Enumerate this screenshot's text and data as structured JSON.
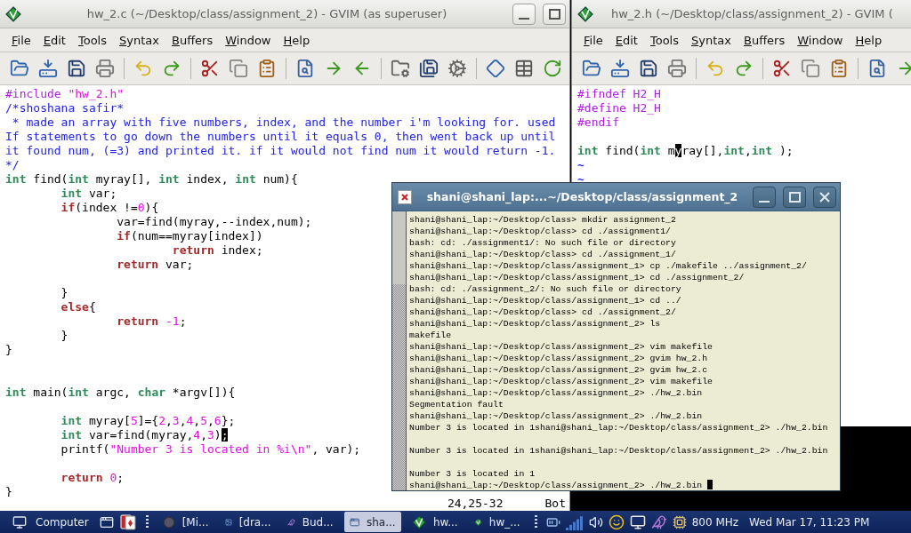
{
  "editor_left": {
    "title": "hw_2.c (~/Desktop/class/assignment_2) - GVIM (as superuser)",
    "menu": [
      "File",
      "Edit",
      "Tools",
      "Syntax",
      "Buffers",
      "Window",
      "Help"
    ],
    "lines": [
      {
        "kind": "code",
        "tokens": [
          {
            "kind": "preproc",
            "text": "#include "
          },
          {
            "kind": "string",
            "text": "\"hw_2.h\""
          }
        ]
      },
      {
        "kind": "code",
        "tokens": [
          {
            "kind": "comment",
            "text": "/*shoshana safir*"
          }
        ]
      },
      {
        "kind": "code",
        "tokens": [
          {
            "kind": "comment",
            "text": " * made an array with five numbers, index, and the number i'm looking for. used"
          }
        ]
      },
      {
        "kind": "code",
        "tokens": [
          {
            "kind": "comment",
            "text": "If statements to go down the numbers until it equals 0, then went back up until"
          }
        ]
      },
      {
        "kind": "code",
        "tokens": [
          {
            "kind": "comment",
            "text": "it found num, (=3) and printed it. if it would not find num it would return -1."
          }
        ]
      },
      {
        "kind": "code",
        "tokens": [
          {
            "kind": "comment",
            "text": "*/"
          }
        ]
      },
      {
        "kind": "code",
        "tokens": [
          {
            "kind": "type",
            "text": "int"
          },
          {
            "kind": "plain",
            "text": " find("
          },
          {
            "kind": "type",
            "text": "int"
          },
          {
            "kind": "plain",
            "text": " myray[], "
          },
          {
            "kind": "type",
            "text": "int"
          },
          {
            "kind": "plain",
            "text": " index, "
          },
          {
            "kind": "type",
            "text": "int"
          },
          {
            "kind": "plain",
            "text": " num){"
          }
        ]
      },
      {
        "kind": "code",
        "tokens": [
          {
            "kind": "type",
            "text": "        int"
          },
          {
            "kind": "plain",
            "text": " var;"
          }
        ]
      },
      {
        "kind": "code",
        "tokens": [
          {
            "kind": "statement",
            "text": "        if"
          },
          {
            "kind": "plain",
            "text": "(index !="
          },
          {
            "kind": "number",
            "text": "0"
          },
          {
            "kind": "plain",
            "text": "){"
          }
        ]
      },
      {
        "kind": "code",
        "tokens": [
          {
            "kind": "plain",
            "text": "                var=find(myray,--index,num);"
          }
        ]
      },
      {
        "kind": "code",
        "tokens": [
          {
            "kind": "statement",
            "text": "                if"
          },
          {
            "kind": "plain",
            "text": "(num==myray[index])"
          }
        ]
      },
      {
        "kind": "code",
        "tokens": [
          {
            "kind": "statement",
            "text": "                        return"
          },
          {
            "kind": "plain",
            "text": " index;"
          }
        ]
      },
      {
        "kind": "code",
        "tokens": [
          {
            "kind": "statement",
            "text": "                return"
          },
          {
            "kind": "plain",
            "text": " var;"
          }
        ]
      },
      {
        "kind": "blank"
      },
      {
        "kind": "code",
        "tokens": [
          {
            "kind": "plain",
            "text": "        }"
          }
        ]
      },
      {
        "kind": "code",
        "tokens": [
          {
            "kind": "statement",
            "text": "        else"
          },
          {
            "kind": "plain",
            "text": "{"
          }
        ]
      },
      {
        "kind": "code",
        "tokens": [
          {
            "kind": "statement",
            "text": "                return "
          },
          {
            "kind": "number",
            "text": "-1"
          },
          {
            "kind": "plain",
            "text": ";"
          }
        ]
      },
      {
        "kind": "code",
        "tokens": [
          {
            "kind": "plain",
            "text": "        }"
          }
        ]
      },
      {
        "kind": "code",
        "tokens": [
          {
            "kind": "plain",
            "text": "}"
          }
        ]
      },
      {
        "kind": "blank"
      },
      {
        "kind": "blank"
      },
      {
        "kind": "code",
        "tokens": [
          {
            "kind": "type",
            "text": "int"
          },
          {
            "kind": "plain",
            "text": " main("
          },
          {
            "kind": "type",
            "text": "int"
          },
          {
            "kind": "plain",
            "text": " argc, "
          },
          {
            "kind": "type",
            "text": "char"
          },
          {
            "kind": "plain",
            "text": " *argv[]){"
          }
        ]
      },
      {
        "kind": "blank"
      },
      {
        "kind": "code",
        "tokens": [
          {
            "kind": "type",
            "text": "        int"
          },
          {
            "kind": "plain",
            "text": " myray["
          },
          {
            "kind": "number",
            "text": "5"
          },
          {
            "kind": "plain",
            "text": "]={"
          },
          {
            "kind": "number",
            "text": "2"
          },
          {
            "kind": "plain",
            "text": ","
          },
          {
            "kind": "number",
            "text": "3"
          },
          {
            "kind": "plain",
            "text": ","
          },
          {
            "kind": "number",
            "text": "4"
          },
          {
            "kind": "plain",
            "text": ","
          },
          {
            "kind": "number",
            "text": "5"
          },
          {
            "kind": "plain",
            "text": ","
          },
          {
            "kind": "number",
            "text": "6"
          },
          {
            "kind": "plain",
            "text": "};"
          }
        ]
      },
      {
        "kind": "code",
        "tokens": [
          {
            "kind": "type",
            "text": "        int"
          },
          {
            "kind": "plain",
            "text": " var=find(myray,"
          },
          {
            "kind": "number",
            "text": "4"
          },
          {
            "kind": "plain",
            "text": ","
          },
          {
            "kind": "number",
            "text": "3"
          },
          {
            "kind": "plain",
            "text": ")"
          },
          {
            "kind": "cursor",
            "text": ";"
          }
        ]
      },
      {
        "kind": "code",
        "tokens": [
          {
            "kind": "plain",
            "text": "        printf("
          },
          {
            "kind": "string",
            "text": "\"Number 3 is located in %i\\n\""
          },
          {
            "kind": "plain",
            "text": ", var);"
          }
        ]
      },
      {
        "kind": "blank"
      },
      {
        "kind": "code",
        "tokens": [
          {
            "kind": "statement",
            "text": "        return "
          },
          {
            "kind": "number",
            "text": "0"
          },
          {
            "kind": "plain",
            "text": ";"
          }
        ]
      },
      {
        "kind": "code",
        "tokens": [
          {
            "kind": "plain",
            "text": "}"
          }
        ]
      }
    ],
    "status": {
      "position": "24,25-32",
      "scroll": "Bot"
    }
  },
  "editor_right": {
    "title": "hw_2.h (~/Desktop/class/assignment_2) - GVIM (",
    "menu": [
      "File",
      "Edit",
      "Tools",
      "Syntax",
      "Buffers",
      "Window",
      "Help"
    ],
    "lines": [
      {
        "kind": "code",
        "tokens": [
          {
            "kind": "preproc",
            "text": "#ifndef H2_H"
          }
        ]
      },
      {
        "kind": "code",
        "tokens": [
          {
            "kind": "preproc",
            "text": "#define H2_H"
          }
        ]
      },
      {
        "kind": "code",
        "tokens": [
          {
            "kind": "preproc",
            "text": "#endif"
          }
        ]
      },
      {
        "kind": "blank"
      },
      {
        "kind": "code",
        "tokens": [
          {
            "kind": "type",
            "text": "int"
          },
          {
            "kind": "plain",
            "text": " find("
          },
          {
            "kind": "type",
            "text": "int"
          },
          {
            "kind": "plain",
            "text": " m"
          },
          {
            "kind": "cursor",
            "text": "y"
          },
          {
            "kind": "plain",
            "text": "ray[],"
          },
          {
            "kind": "type",
            "text": "int"
          },
          {
            "kind": "plain",
            "text": ","
          },
          {
            "kind": "type",
            "text": "int"
          },
          {
            "kind": "plain",
            "text": " );"
          }
        ]
      },
      {
        "kind": "filler",
        "text": "~"
      },
      {
        "kind": "filler",
        "text": "~"
      }
    ]
  },
  "terminal": {
    "title": "shani@shani_lap:...~/Desktop/class/assignment_2",
    "cursor": true,
    "lines": [
      {
        "kind": "text",
        "text": "shani@shani_lap:~/Desktop/class> mkdir assignment_2"
      },
      {
        "kind": "text",
        "text": "shani@shani_lap:~/Desktop/class> cd ./assignment1/"
      },
      {
        "kind": "text",
        "text": "bash: cd: ./assignment1/: No such file or directory"
      },
      {
        "kind": "text",
        "text": "shani@shani_lap:~/Desktop/class> cd ./assignment_1/"
      },
      {
        "kind": "text",
        "text": "shani@shani_lap:~/Desktop/class/assignment_1> cp ./makefile ../assignment_2/"
      },
      {
        "kind": "text",
        "text": "shani@shani_lap:~/Desktop/class/assignment_1> cd ./assignment_2/"
      },
      {
        "kind": "text",
        "text": "bash: cd: ./assignment_2/: No such file or directory"
      },
      {
        "kind": "text",
        "text": "shani@shani_lap:~/Desktop/class/assignment_1> cd ../"
      },
      {
        "kind": "text",
        "text": "shani@shani_lap:~/Desktop/class> cd ./assignment_2/"
      },
      {
        "kind": "text",
        "text": "shani@shani_lap:~/Desktop/class/assignment_2> ls"
      },
      {
        "kind": "text",
        "text": "makefile"
      },
      {
        "kind": "text",
        "text": "shani@shani_lap:~/Desktop/class/assignment_2> vim makefile"
      },
      {
        "kind": "text",
        "text": "shani@shani_lap:~/Desktop/class/assignment_2> gvim hw_2.h"
      },
      {
        "kind": "text",
        "text": "shani@shani_lap:~/Desktop/class/assignment_2> gvim hw_2.c"
      },
      {
        "kind": "text",
        "text": "shani@shani_lap:~/Desktop/class/assignment_2> vim makefile"
      },
      {
        "kind": "text",
        "text": "shani@shani_lap:~/Desktop/class/assignment_2> ./hw_2.bin"
      },
      {
        "kind": "text",
        "text": "Segmentation fault"
      },
      {
        "kind": "text",
        "text": "shani@shani_lap:~/Desktop/class/assignment_2> ./hw_2.bin"
      },
      {
        "kind": "text",
        "text": "Number 3 is located in 1shani@shani_lap:~/Desktop/class/assignment_2> ./hw_2.bin"
      },
      {
        "kind": "blank"
      },
      {
        "kind": "text",
        "text": "Number 3 is located in 1shani@shani_lap:~/Desktop/class/assignment_2> ./hw_2.bin"
      },
      {
        "kind": "blank"
      },
      {
        "kind": "text",
        "text": "Number 3 is located in 1"
      },
      {
        "kind": "text",
        "text": "shani@shani_lap:~/Desktop/class/assignment_2> ./hw_2.bin"
      }
    ]
  },
  "taskbar": {
    "start": "Computer",
    "tasks": [
      {
        "kind": "ball",
        "label": "[Mi...",
        "selected": false
      },
      {
        "kind": "image",
        "label": "[dra...",
        "selected": false
      },
      {
        "kind": "bird",
        "label": "Bud...",
        "selected": false
      },
      {
        "kind": "window",
        "label": "sha...",
        "selected": true
      },
      {
        "kind": "vim",
        "label": "hw...",
        "selected": false
      },
      {
        "kind": "vim",
        "label": "hw_...",
        "selected": false
      }
    ],
    "cpu": "800 MHz",
    "clock": "Wed Mar 17, 11:23 PM"
  }
}
